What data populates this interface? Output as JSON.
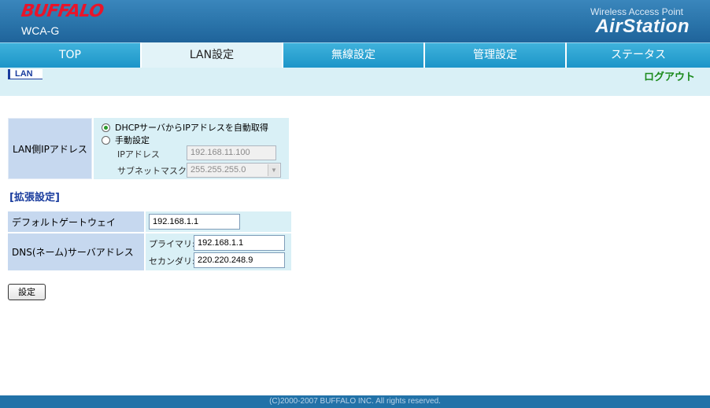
{
  "header": {
    "brand": "BUFFALO",
    "model": "WCA-G",
    "product_line": "Wireless Access Point",
    "product_name": "AirStation"
  },
  "tabs": [
    {
      "label": "TOP",
      "active": false
    },
    {
      "label": "LAN設定",
      "active": true
    },
    {
      "label": "無線設定",
      "active": false
    },
    {
      "label": "管理設定",
      "active": false
    },
    {
      "label": "ステータス",
      "active": false
    }
  ],
  "subnav": {
    "current": "LAN",
    "logout": "ログアウト"
  },
  "lan": {
    "label": "LAN側IPアドレス",
    "option_dhcp": "DHCPサーバからIPアドレスを自動取得",
    "option_manual": "手動設定",
    "selected": "dhcp",
    "ip_label": "IPアドレス",
    "ip_value": "192.168.11.100",
    "subnet_label": "サブネットマスク",
    "subnet_value": "255.255.255.0"
  },
  "extended": {
    "heading": "[拡張設定]",
    "gateway_label": "デフォルトゲートウェイ",
    "gateway_value": "192.168.1.1",
    "dns_label": "DNS(ネーム)サーバアドレス",
    "primary_label": "プライマリ:",
    "primary_value": "192.168.1.1",
    "secondary_label": "セカンダリ:",
    "secondary_value": "220.220.248.9"
  },
  "actions": {
    "save_label": "設定"
  },
  "footer": {
    "copyright": "(C)2000-2007 BUFFALO INC. All rights reserved."
  },
  "colors": {
    "header_blue": "#2a74aa",
    "tab_blue": "#1c95c8",
    "brand_red": "#e8152b",
    "logout_green": "#1b8a1b",
    "label_cell": "#c6d8ef",
    "value_cell": "#d9f0f6"
  }
}
